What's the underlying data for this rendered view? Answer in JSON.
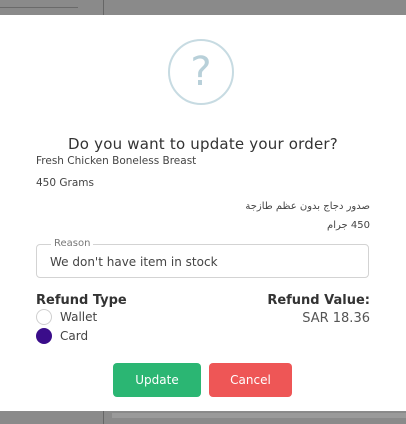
{
  "modal": {
    "icon": "question-mark-icon",
    "icon_glyph": "?",
    "title": "Do you want to update your order?",
    "product": {
      "name_en": "Fresh Chicken Boneless Breast",
      "qty_en": "450 Grams",
      "name_ar": "صدور دجاج بدون عظم طازجة",
      "qty_ar": "450 جرام"
    },
    "reason": {
      "legend": "Reason",
      "value": "We don't have item in stock"
    },
    "refund_type": {
      "label": "Refund Type",
      "options": [
        {
          "label": "Wallet",
          "selected": false
        },
        {
          "label": "Card",
          "selected": true
        }
      ]
    },
    "refund_value": {
      "label": "Refund Value:",
      "amount": "SAR 18.36"
    },
    "buttons": {
      "update": "Update",
      "cancel": "Cancel"
    }
  },
  "colors": {
    "update_button": "#2bb673",
    "cancel_button": "#ee5656",
    "radio_selected": "#3a0d8a",
    "overlay": "#6f6f6f"
  }
}
